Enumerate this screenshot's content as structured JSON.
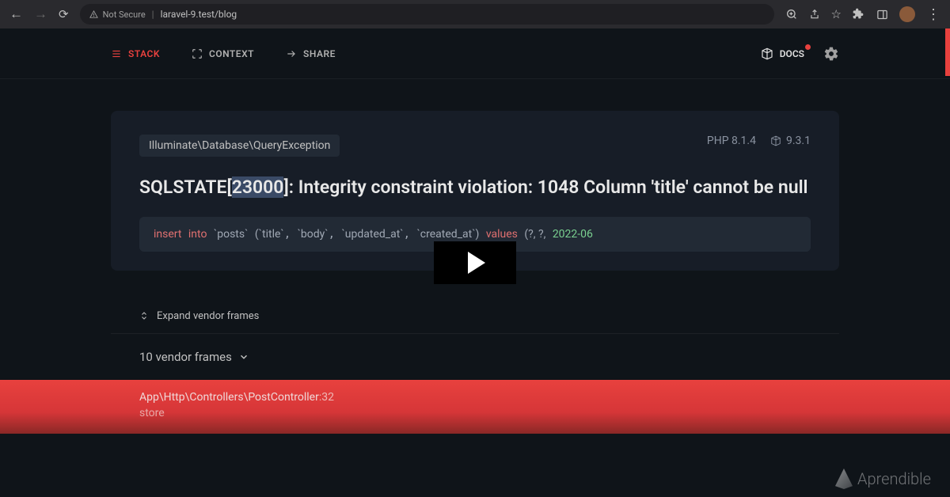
{
  "browser": {
    "not_secure": "Not Secure",
    "url": "laravel-9.test/blog"
  },
  "nav": {
    "stack": "STACK",
    "context": "CONTEXT",
    "share": "SHARE",
    "docs": "DOCS"
  },
  "error": {
    "exception_class": "Illuminate\\Database\\QueryException",
    "php_version": "PHP 8.1.4",
    "laravel_version": "9.3.1",
    "title_pre": "SQLSTATE[",
    "sqlstate_code": "23000",
    "title_post": "]: Integrity constraint violation: 1048 Column 'title' cannot be null",
    "sql": {
      "kw_insert": "insert",
      "kw_into": "into",
      "table": "`posts`",
      "cols_pre": "(",
      "col1": "`title`",
      "col2": "`body`",
      "col3": "`updated_at`",
      "col4": "`created_at`",
      "cols_post": ")",
      "kw_values": "values",
      "vals": "(?, ?,",
      "date": "2022-06"
    }
  },
  "frames": {
    "expand_label": "Expand vendor frames",
    "vendor_count": "10 vendor frames",
    "active_path": "App\\Http\\Controllers\\PostController",
    "active_line": ":32",
    "active_method": "store"
  },
  "watermark": "Aprendible"
}
